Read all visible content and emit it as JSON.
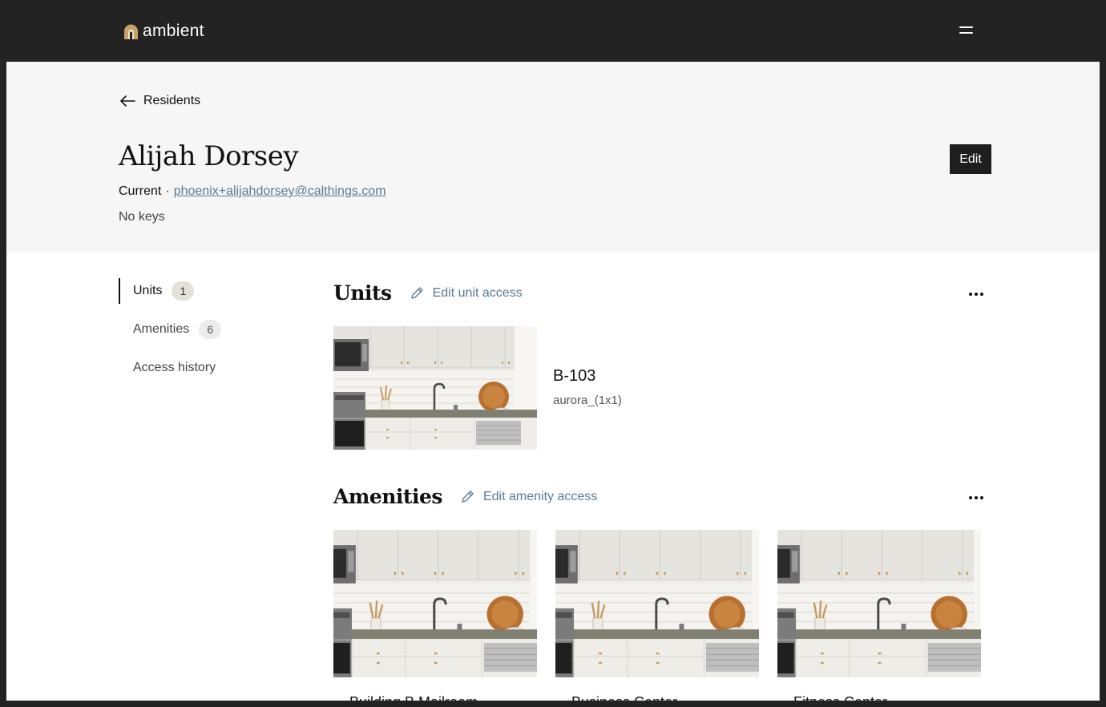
{
  "app": {
    "brand": "ambient",
    "accent": "#c9a26a"
  },
  "header": {
    "menu_icon": "hamburger-icon"
  },
  "breadcrumb": {
    "back_label": "Residents",
    "back_icon": "arrow-left-icon"
  },
  "resident": {
    "name": "Alijah Dorsey",
    "status": "Current",
    "email": "phoenix+alijahdorsey@calthings.com",
    "keys": "No keys",
    "edit_label": "Edit"
  },
  "side_nav": {
    "items": [
      {
        "label": "Units",
        "count": "1",
        "active": true
      },
      {
        "label": "Amenities",
        "count": "6",
        "active": false
      },
      {
        "label": "Access history",
        "count": "",
        "active": false
      }
    ]
  },
  "units_section": {
    "title": "Units",
    "edit_label": "Edit unit access",
    "units": [
      {
        "name": "B-103",
        "type": "aurora_(1x1)"
      }
    ]
  },
  "amenities_section": {
    "title": "Amenities",
    "edit_label": "Edit amenity access",
    "items": [
      {
        "name": "Building B Mailroom"
      },
      {
        "name": "Business Center"
      },
      {
        "name": "Fitness Center"
      }
    ]
  }
}
